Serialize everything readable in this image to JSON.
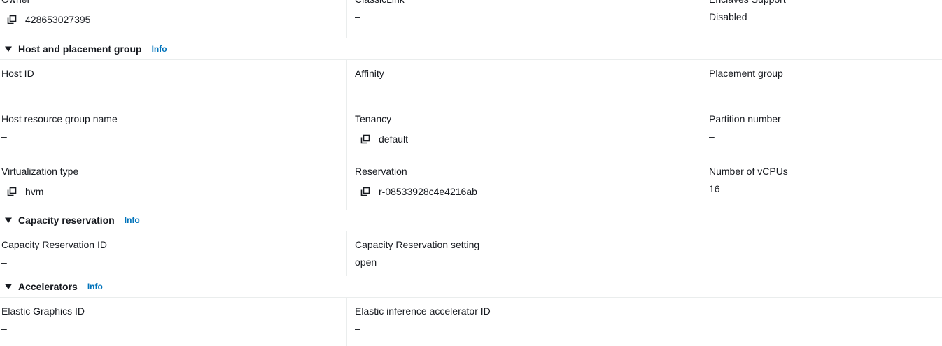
{
  "top_row": {
    "owner": {
      "label": "Owner",
      "value": "428653027395"
    },
    "classiclink": {
      "label": "ClassicLink",
      "value": "–"
    },
    "enclaves_support": {
      "label": "Enclaves Support",
      "value": "Disabled"
    }
  },
  "host_placement": {
    "title": "Host and placement group",
    "info": "Info",
    "fields": {
      "host_id": {
        "label": "Host ID",
        "value": "–"
      },
      "affinity": {
        "label": "Affinity",
        "value": "–"
      },
      "placement_group": {
        "label": "Placement group",
        "value": "–"
      },
      "host_resource_group_name": {
        "label": "Host resource group name",
        "value": "–"
      },
      "tenancy": {
        "label": "Tenancy",
        "value": "default"
      },
      "partition_number": {
        "label": "Partition number",
        "value": "–"
      },
      "virtualization_type": {
        "label": "Virtualization type",
        "value": "hvm"
      },
      "reservation": {
        "label": "Reservation",
        "value": "r-08533928c4e4216ab"
      },
      "number_of_vcpus": {
        "label": "Number of vCPUs",
        "value": "16"
      }
    }
  },
  "capacity_reservation": {
    "title": "Capacity reservation",
    "info": "Info",
    "fields": {
      "capacity_reservation_id": {
        "label": "Capacity Reservation ID",
        "value": "–"
      },
      "capacity_reservation_setting": {
        "label": "Capacity Reservation setting",
        "value": "open"
      }
    }
  },
  "accelerators": {
    "title": "Accelerators",
    "info": "Info",
    "fields": {
      "elastic_graphics_id": {
        "label": "Elastic Graphics ID",
        "value": "–"
      },
      "elastic_inference_accelerator_id": {
        "label": "Elastic inference accelerator ID",
        "value": "–"
      }
    }
  },
  "icons": {
    "copy": "copy-icon",
    "caret": "caret-down-icon"
  },
  "colors": {
    "text": "#16191f",
    "link": "#0073bb",
    "divider": "#eaeded"
  }
}
